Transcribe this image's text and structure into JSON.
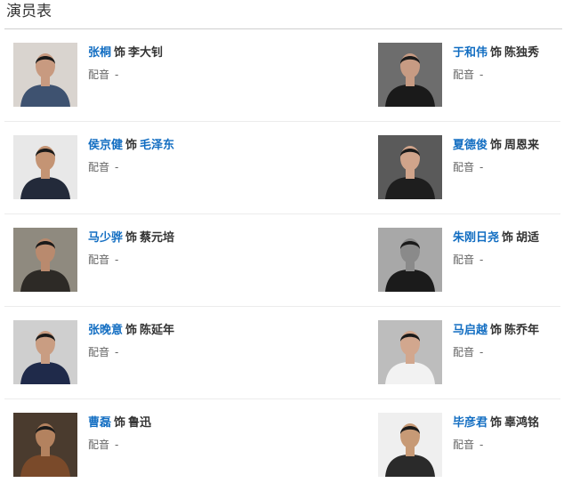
{
  "section": {
    "title": "演员表"
  },
  "labels": {
    "role_prefix": "饰",
    "dub_label": "配音",
    "dub_value": "-"
  },
  "cast": [
    {
      "actor": "张桐",
      "role": "李大钊",
      "role_linked": false,
      "bg": "#d9d4cf",
      "skin": "#c89a80",
      "cloth": "#3e5270"
    },
    {
      "actor": "于和伟",
      "role": "陈独秀",
      "role_linked": false,
      "bg": "#6d6d6d",
      "skin": "#c79b83",
      "cloth": "#1a1a1a"
    },
    {
      "actor": "侯京健",
      "role": "毛泽东",
      "role_linked": true,
      "bg": "#e8e8e8",
      "skin": "#c49474",
      "cloth": "#232a3a"
    },
    {
      "actor": "夏德俊",
      "role": "周恩来",
      "role_linked": false,
      "bg": "#5a5a5a",
      "skin": "#d0a48b",
      "cloth": "#1e1e1e"
    },
    {
      "actor": "马少骅",
      "role": "蔡元培",
      "role_linked": false,
      "bg": "#8f8a7f",
      "skin": "#b98a6e",
      "cloth": "#2d2a26"
    },
    {
      "actor": "朱刚日尧",
      "role": "胡适",
      "role_linked": false,
      "bg": "#a8a8a8",
      "skin": "#8a8a8a",
      "cloth": "#1b1b1b"
    },
    {
      "actor": "张晚意",
      "role": "陈延年",
      "role_linked": false,
      "bg": "#cfcfcf",
      "skin": "#c99d82",
      "cloth": "#1f2a4a"
    },
    {
      "actor": "马启越",
      "role": "陈乔年",
      "role_linked": false,
      "bg": "#bdbdbd",
      "skin": "#d2a78e",
      "cloth": "#f2f2f2"
    },
    {
      "actor": "曹磊",
      "role": "鲁迅",
      "role_linked": false,
      "bg": "#4a3b2e",
      "skin": "#b3825f",
      "cloth": "#7a4a2a"
    },
    {
      "actor": "毕彦君",
      "role": "辜鸿铭",
      "role_linked": false,
      "bg": "#efefef",
      "skin": "#c79a76",
      "cloth": "#2a2a2a"
    }
  ]
}
